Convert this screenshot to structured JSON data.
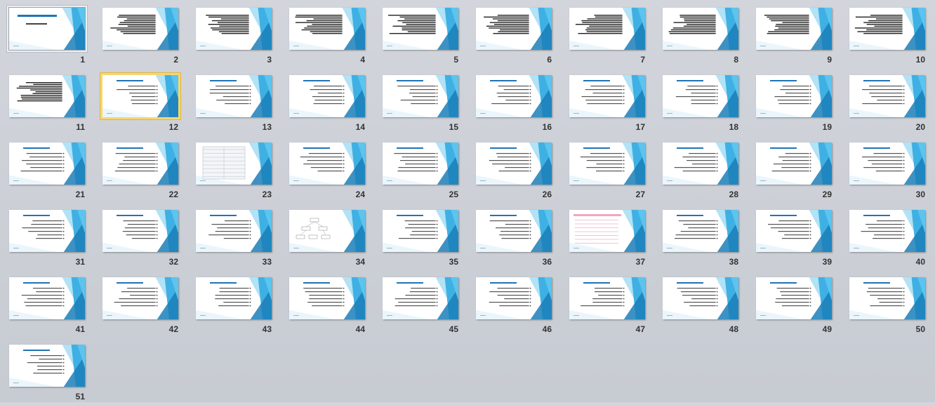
{
  "view": "slide-sorter",
  "colors": {
    "background": "#c9cdd4",
    "accent_dark": "#1b7fb8",
    "accent_mid": "#3fb0e3",
    "accent_light": "#a9dff5",
    "title_blue": "#1f74b5",
    "selection": "#f2c94c"
  },
  "selected_slide": 1,
  "hover_slide": 12,
  "slides": [
    {
      "number": "1",
      "layout": "title"
    },
    {
      "number": "2",
      "layout": "dense"
    },
    {
      "number": "3",
      "layout": "dense"
    },
    {
      "number": "4",
      "layout": "dense"
    },
    {
      "number": "5",
      "layout": "dense"
    },
    {
      "number": "6",
      "layout": "dense"
    },
    {
      "number": "7",
      "layout": "dense"
    },
    {
      "number": "8",
      "layout": "dense"
    },
    {
      "number": "9",
      "layout": "dense"
    },
    {
      "number": "10",
      "layout": "dense"
    },
    {
      "number": "11",
      "layout": "dense"
    },
    {
      "number": "12",
      "layout": "bullets"
    },
    {
      "number": "13",
      "layout": "bullets"
    },
    {
      "number": "14",
      "layout": "bullets"
    },
    {
      "number": "15",
      "layout": "bullets"
    },
    {
      "number": "16",
      "layout": "bullets"
    },
    {
      "number": "17",
      "layout": "bullets"
    },
    {
      "number": "18",
      "layout": "bullets"
    },
    {
      "number": "19",
      "layout": "bullets"
    },
    {
      "number": "20",
      "layout": "bullets"
    },
    {
      "number": "21",
      "layout": "bullets"
    },
    {
      "number": "22",
      "layout": "bullets"
    },
    {
      "number": "23",
      "layout": "table"
    },
    {
      "number": "24",
      "layout": "bullets"
    },
    {
      "number": "25",
      "layout": "bullets"
    },
    {
      "number": "26",
      "layout": "bullets"
    },
    {
      "number": "27",
      "layout": "bullets"
    },
    {
      "number": "28",
      "layout": "bullets"
    },
    {
      "number": "29",
      "layout": "bullets"
    },
    {
      "number": "30",
      "layout": "bullets"
    },
    {
      "number": "31",
      "layout": "bullets"
    },
    {
      "number": "32",
      "layout": "bullets"
    },
    {
      "number": "33",
      "layout": "bullets"
    },
    {
      "number": "34",
      "layout": "diagram"
    },
    {
      "number": "35",
      "layout": "bullets"
    },
    {
      "number": "36",
      "layout": "bullets"
    },
    {
      "number": "37",
      "layout": "pinktable"
    },
    {
      "number": "38",
      "layout": "bullets"
    },
    {
      "number": "39",
      "layout": "bullets"
    },
    {
      "number": "40",
      "layout": "bullets"
    },
    {
      "number": "41",
      "layout": "bullets"
    },
    {
      "number": "42",
      "layout": "bullets"
    },
    {
      "number": "43",
      "layout": "bullets"
    },
    {
      "number": "44",
      "layout": "bullets"
    },
    {
      "number": "45",
      "layout": "bullets"
    },
    {
      "number": "46",
      "layout": "bullets"
    },
    {
      "number": "47",
      "layout": "bullets"
    },
    {
      "number": "48",
      "layout": "bullets"
    },
    {
      "number": "49",
      "layout": "bullets"
    },
    {
      "number": "50",
      "layout": "bullets"
    },
    {
      "number": "51",
      "layout": "bullets"
    }
  ]
}
